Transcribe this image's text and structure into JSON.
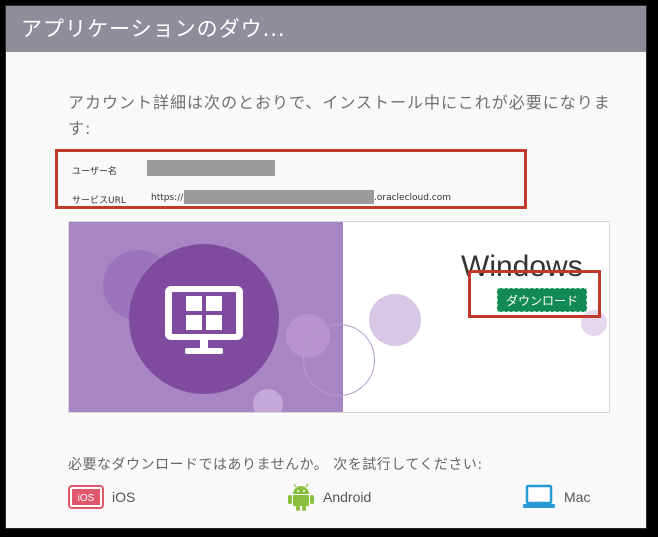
{
  "window": {
    "title": "アプリケーションのダウ..."
  },
  "intro": {
    "text": "アカウント詳細は次のとおりで、インストール中にこれが必要になります:"
  },
  "credentials": {
    "username_label": "ユーザー名",
    "service_url_label": "サービスURL",
    "service_url_prefix": "https://",
    "service_url_suffix": ".oraclecloud.com"
  },
  "download_card": {
    "os_name": "Windows",
    "download_button": "ダウンロード",
    "accent_color": "#128a55",
    "tile_color": "#a885c3",
    "icon": "monitor-windows-icon"
  },
  "alternatives": {
    "prompt": "必要なダウンロードではありませんか。 次を試行してください:",
    "platforms": [
      {
        "label": "iOS",
        "icon": "ios-icon"
      },
      {
        "label": "Android",
        "icon": "android-icon"
      },
      {
        "label": "Mac",
        "icon": "laptop-icon"
      }
    ]
  },
  "highlight_color": "#c0392b"
}
